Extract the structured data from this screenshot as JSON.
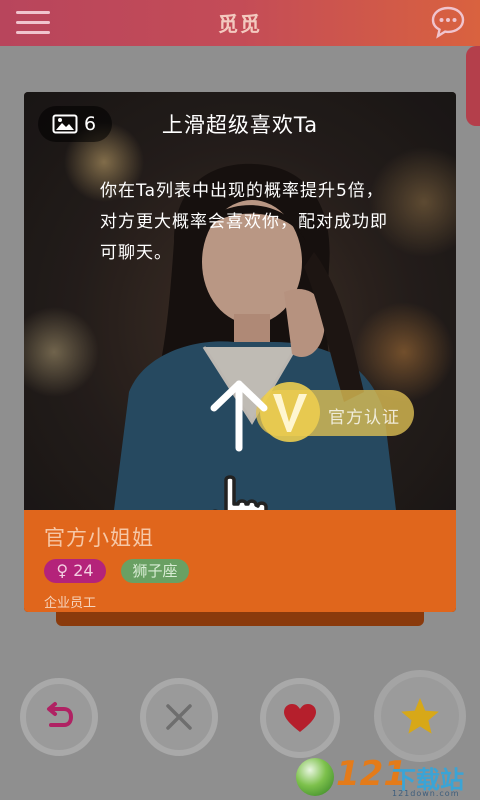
{
  "app": {
    "title": "觅觅"
  },
  "header": {
    "menu_icon": "menu-icon",
    "chat_icon": "chat-bubble-icon"
  },
  "card": {
    "photo_count": "6",
    "tip_title": "上滑超级喜欢Ta",
    "tip_body": "你在Ta列表中出现的概率提升5倍，对方更大概率会喜欢你，配对成功即可聊天。",
    "badge_label": "官方认证",
    "name": "官方小姐姐",
    "gender_symbol": "♀",
    "age": "24",
    "zodiac": "狮子座",
    "occupation": "企业员工"
  },
  "actions": [
    {
      "name": "undo",
      "icon": "undo-icon"
    },
    {
      "name": "pass",
      "icon": "close-icon"
    },
    {
      "name": "like",
      "icon": "heart-icon"
    },
    {
      "name": "super-like",
      "icon": "star-icon"
    }
  ],
  "colors": {
    "accent_pink": "#c44c57",
    "info_orange": "#e0661c",
    "heart": "#b51f2c",
    "star": "#d7a818",
    "undo": "#b02263"
  },
  "watermark": {
    "number": "121",
    "text": "下载站",
    "domain": "121down.com"
  }
}
